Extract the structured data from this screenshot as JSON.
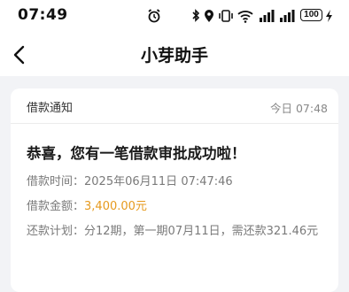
{
  "status_bar": {
    "time": "07:49",
    "battery_level": "100",
    "icons": [
      "alarm-icon",
      "bluetooth-icon",
      "location-icon",
      "vibrate-icon",
      "wifi-icon",
      "signal-icon",
      "signal-icon",
      "battery-icon",
      "charging-icon"
    ]
  },
  "nav": {
    "title": "小芽助手",
    "back_icon": "chevron-left-icon"
  },
  "message": {
    "category": "借款通知",
    "time": "今日 07:48",
    "headline": "恭喜，您有一笔借款审批成功啦！",
    "details": [
      {
        "label": "借款时间：",
        "value": "2025年06月11日 07:47:46"
      },
      {
        "label": "借款金额：",
        "value": "3,400.00元"
      },
      {
        "label": "还款计划：",
        "value": "分12期，第一期07月11日，需还款321.46元"
      }
    ],
    "amount_color": "#e69a1e"
  }
}
